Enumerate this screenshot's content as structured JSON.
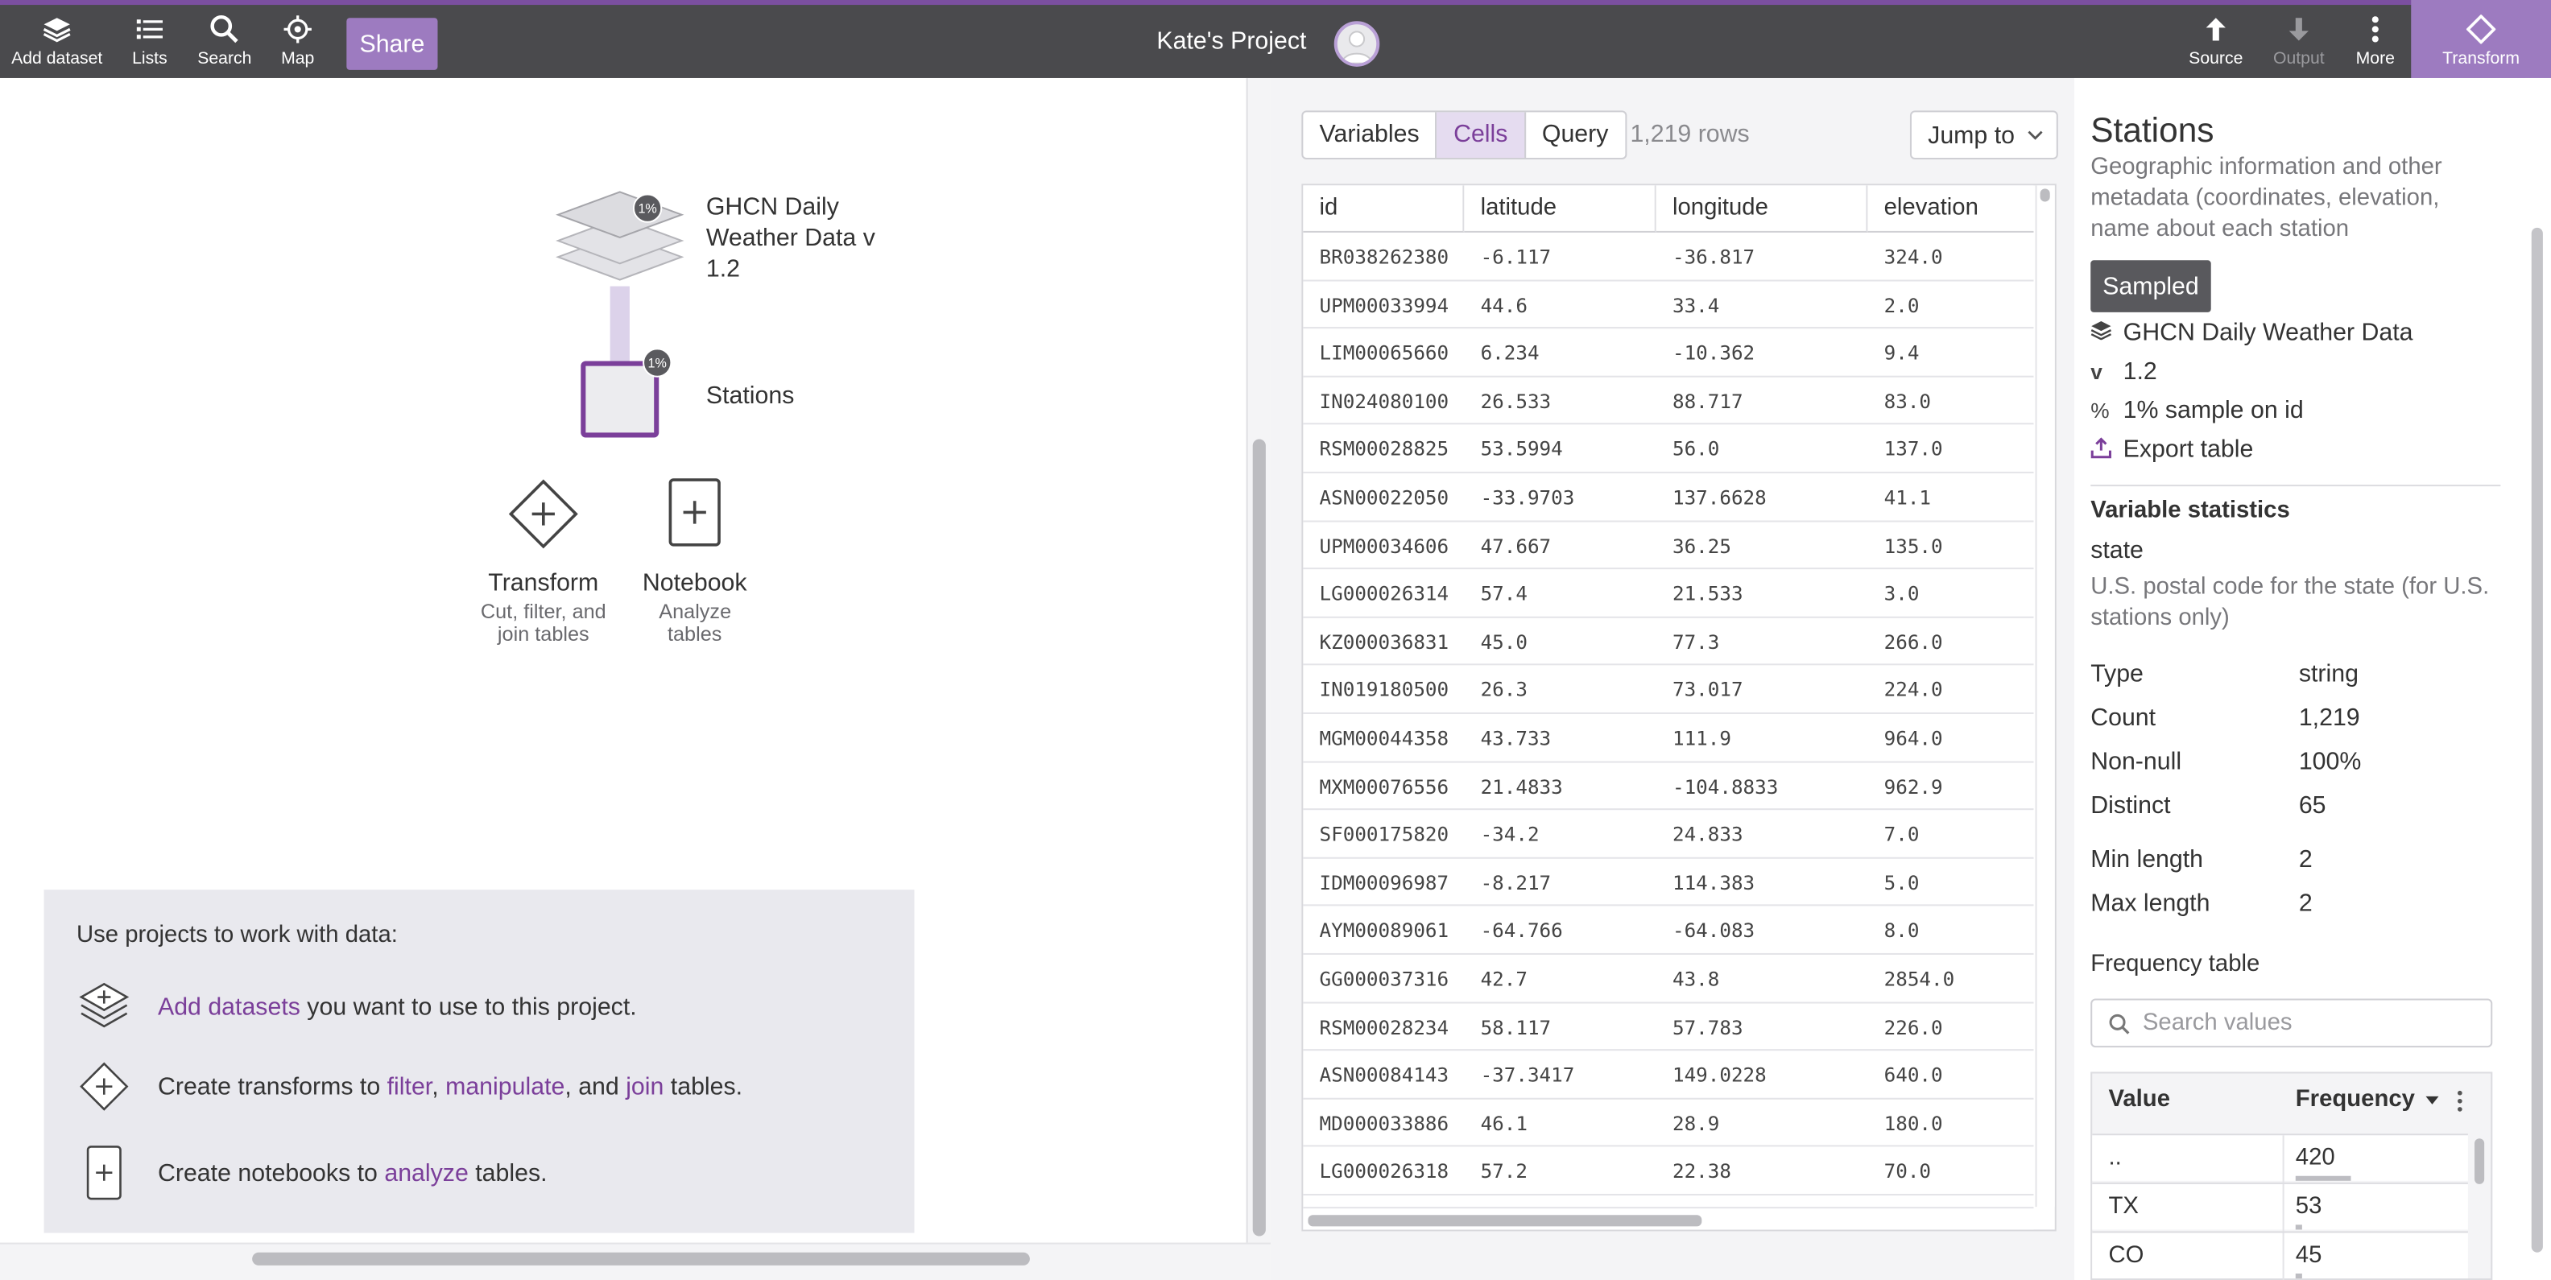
{
  "topbar": {
    "add_dataset": "Add dataset",
    "lists": "Lists",
    "search": "Search",
    "map": "Map",
    "share": "Share",
    "project_title": "Kate's Project",
    "source": "Source",
    "output": "Output",
    "more": "More",
    "transform": "Transform"
  },
  "graph": {
    "dataset_label": "GHCN Daily Weather Data v 1.2",
    "dataset_badge": "1%",
    "stations_label": "Stations",
    "stations_badge": "1%",
    "transform_title": "Transform",
    "transform_sub": "Cut, filter, and join tables",
    "notebook_title": "Notebook",
    "notebook_sub": "Analyze tables"
  },
  "help": {
    "heading": "Use projects to work with data:",
    "row1": {
      "link": "Add datasets",
      "rest": " you want to use to this project."
    },
    "row2": {
      "pre": "Create transforms to ",
      "l1": "filter",
      "c1": ", ",
      "l2": "manipulate",
      "c2": ", and ",
      "l3": "join",
      "post": " tables."
    },
    "row3": {
      "pre": "Create notebooks to ",
      "link": "analyze",
      "post": " tables."
    }
  },
  "table": {
    "tabs": [
      "Variables",
      "Cells",
      "Query"
    ],
    "active_tab": "Cells",
    "rows_count": "1,219 rows",
    "jump_to": "Jump to",
    "columns": [
      "id",
      "latitude",
      "longitude",
      "elevation"
    ],
    "rows": [
      [
        "BR038262380",
        "-6.117",
        "-36.817",
        "324.0"
      ],
      [
        "UPM00033994",
        "44.6",
        "33.4",
        "2.0"
      ],
      [
        "LIM00065660",
        "6.234",
        "-10.362",
        "9.4"
      ],
      [
        "IN024080100",
        "26.533",
        "88.717",
        "83.0"
      ],
      [
        "RSM00028825",
        "53.5994",
        "56.0",
        "137.0"
      ],
      [
        "ASN00022050",
        "-33.9703",
        "137.6628",
        "41.1"
      ],
      [
        "UPM00034606",
        "47.667",
        "36.25",
        "135.0"
      ],
      [
        "LG000026314",
        "57.4",
        "21.533",
        "3.0"
      ],
      [
        "KZ000036831",
        "45.0",
        "77.3",
        "266.0"
      ],
      [
        "IN019180500",
        "26.3",
        "73.017",
        "224.0"
      ],
      [
        "MGM00044358",
        "43.733",
        "111.9",
        "964.0"
      ],
      [
        "MXM00076556",
        "21.4833",
        "-104.8833",
        "962.9"
      ],
      [
        "SF000175820",
        "-34.2",
        "24.833",
        "7.0"
      ],
      [
        "IDM00096987",
        "-8.217",
        "114.383",
        "5.0"
      ],
      [
        "AYM00089061",
        "-64.766",
        "-64.083",
        "8.0"
      ],
      [
        "GG000037316",
        "42.7",
        "43.8",
        "2854.0"
      ],
      [
        "RSM00028234",
        "58.117",
        "57.783",
        "226.0"
      ],
      [
        "ASN00084143",
        "-37.3417",
        "149.0228",
        "640.0"
      ],
      [
        "MD000033886",
        "46.1",
        "28.9",
        "180.0"
      ],
      [
        "LG000026318",
        "57.2",
        "22.38",
        "70.0"
      ]
    ]
  },
  "details": {
    "title": "Stations",
    "description": "Geographic information and other metadata (coordinates, elevation, name about each station",
    "sampled": "Sampled",
    "dataset": "GHCN Daily Weather Data",
    "version_icon": "v",
    "version": "1.2",
    "sample_icon": "%",
    "sample": "1% sample on id",
    "export": "Export table",
    "var_stats_heading": "Variable statistics",
    "variable": "state",
    "variable_desc": "U.S. postal code for the state (for U.S. stations only)",
    "stats": [
      {
        "k": "Type",
        "v": "string"
      },
      {
        "k": "Count",
        "v": "1,219"
      },
      {
        "k": "Non-null",
        "v": "100%"
      },
      {
        "k": "Distinct",
        "v": "65"
      },
      {
        "k": "Min length",
        "v": "2"
      },
      {
        "k": "Max length",
        "v": "2"
      }
    ],
    "freq_heading": "Frequency table",
    "search_placeholder": "Search values",
    "freq_col_value": "Value",
    "freq_col_freq": "Frequency",
    "freq_rows": [
      {
        "value": "..",
        "count": "420",
        "fraction": 1.0
      },
      {
        "value": "TX",
        "count": "53",
        "fraction": 0.126
      },
      {
        "value": "CO",
        "count": "45",
        "fraction": 0.107
      }
    ]
  },
  "colors": {
    "accent": "#7b3f9a",
    "topbar": "#4a4a4d",
    "transform_tab": "#9d7bc0"
  }
}
